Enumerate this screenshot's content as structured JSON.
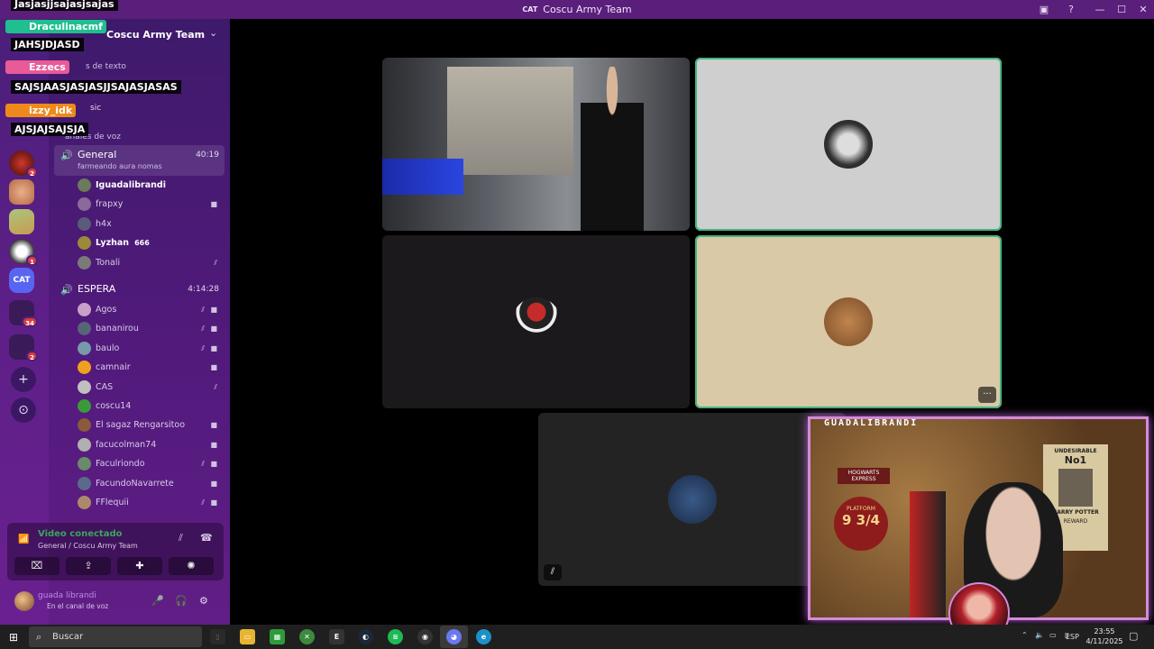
{
  "window": {
    "title": "Coscu Army Team",
    "app_icon": "CAT"
  },
  "server": {
    "name": "Coscu Army Team"
  },
  "categories": {
    "text": "s de texto",
    "music_partial": "sic",
    "voice": "anales de voz"
  },
  "voice_channels": [
    {
      "name": "General",
      "time": "40:19",
      "status": "farmeando aura nomas",
      "members": [
        {
          "name": "Iguadalibrandi",
          "bold": true,
          "icons": []
        },
        {
          "name": "frapxy",
          "icons": [
            "camera-icon"
          ]
        },
        {
          "name": "h4x",
          "icons": []
        },
        {
          "name": "Lyzhan",
          "bold": true,
          "tag": "666",
          "icons": []
        },
        {
          "name": "Tonali",
          "icons": [
            "mic-muted-icon"
          ]
        }
      ]
    },
    {
      "name": "ESPERA",
      "time": "4:14:28",
      "members": [
        {
          "name": "Agos",
          "icons": [
            "mic-muted-icon",
            "camera-icon"
          ]
        },
        {
          "name": "bananirou",
          "icons": [
            "mic-muted-icon",
            "camera-icon"
          ]
        },
        {
          "name": "baulo",
          "icons": [
            "mic-muted-icon",
            "camera-icon"
          ]
        },
        {
          "name": "camnair",
          "icons": [
            "camera-icon"
          ]
        },
        {
          "name": "CAS",
          "icons": [
            "mic-muted-icon"
          ]
        },
        {
          "name": "coscu14",
          "icons": []
        },
        {
          "name": "El sagaz Rengarsitoo",
          "icons": [
            "camera-icon"
          ]
        },
        {
          "name": "facucolman74",
          "icons": [
            "camera-icon"
          ]
        },
        {
          "name": "Faculriondo",
          "icons": [
            "mic-muted-icon",
            "camera-icon"
          ]
        },
        {
          "name": "FacundoNavarrete",
          "icons": [
            "camera-icon"
          ]
        },
        {
          "name": "FFlequii",
          "icons": [
            "mic-muted-icon",
            "camera-icon"
          ]
        }
      ]
    }
  ],
  "guild_badges": [
    "2",
    "1",
    "34",
    "2"
  ],
  "rail_selected": "CAT",
  "voice_panel": {
    "status": "Video conectado",
    "location": "General / Coscu Army Team"
  },
  "user": {
    "display": "guada librandi",
    "status": "En el canal de voz"
  },
  "chat_overlay": [
    {
      "kind": "msg",
      "text": "Jasjasjjsajasjsajas"
    },
    {
      "kind": "name",
      "text": "Draculinacmf",
      "color": "#1fbf8f"
    },
    {
      "kind": "msg",
      "text": "JAHSJDJASD"
    },
    {
      "kind": "name",
      "text": "Ezzecs",
      "color": "#e85b98"
    },
    {
      "kind": "msg",
      "text": "SAJSJAASJASJASJJSAJASJASAS"
    },
    {
      "kind": "name",
      "text": "izzy_idk",
      "color": "#ee8a1c",
      "badge": "1"
    },
    {
      "kind": "msg",
      "text": "AJSJAJSAJSJA"
    }
  ],
  "facecam": {
    "name": "GUADALIBRANDI",
    "poster_title": "UNDESIRABLE",
    "poster_number": "No1",
    "poster_name": "HARRY POTTER",
    "platform_text": "PLATFORM",
    "platform_number": "9 3/4",
    "hogwarts_sign": "HOGWARTS EXPRESS",
    "reward_text": "REWARD"
  },
  "taskbar": {
    "search_placeholder": "Buscar",
    "language": "ESP",
    "time": "23:55",
    "date": "4/11/2025"
  },
  "colors": {
    "accent_green": "#3ba55d",
    "speaking_border": "#43b581",
    "sidebar": "#521a7c"
  }
}
